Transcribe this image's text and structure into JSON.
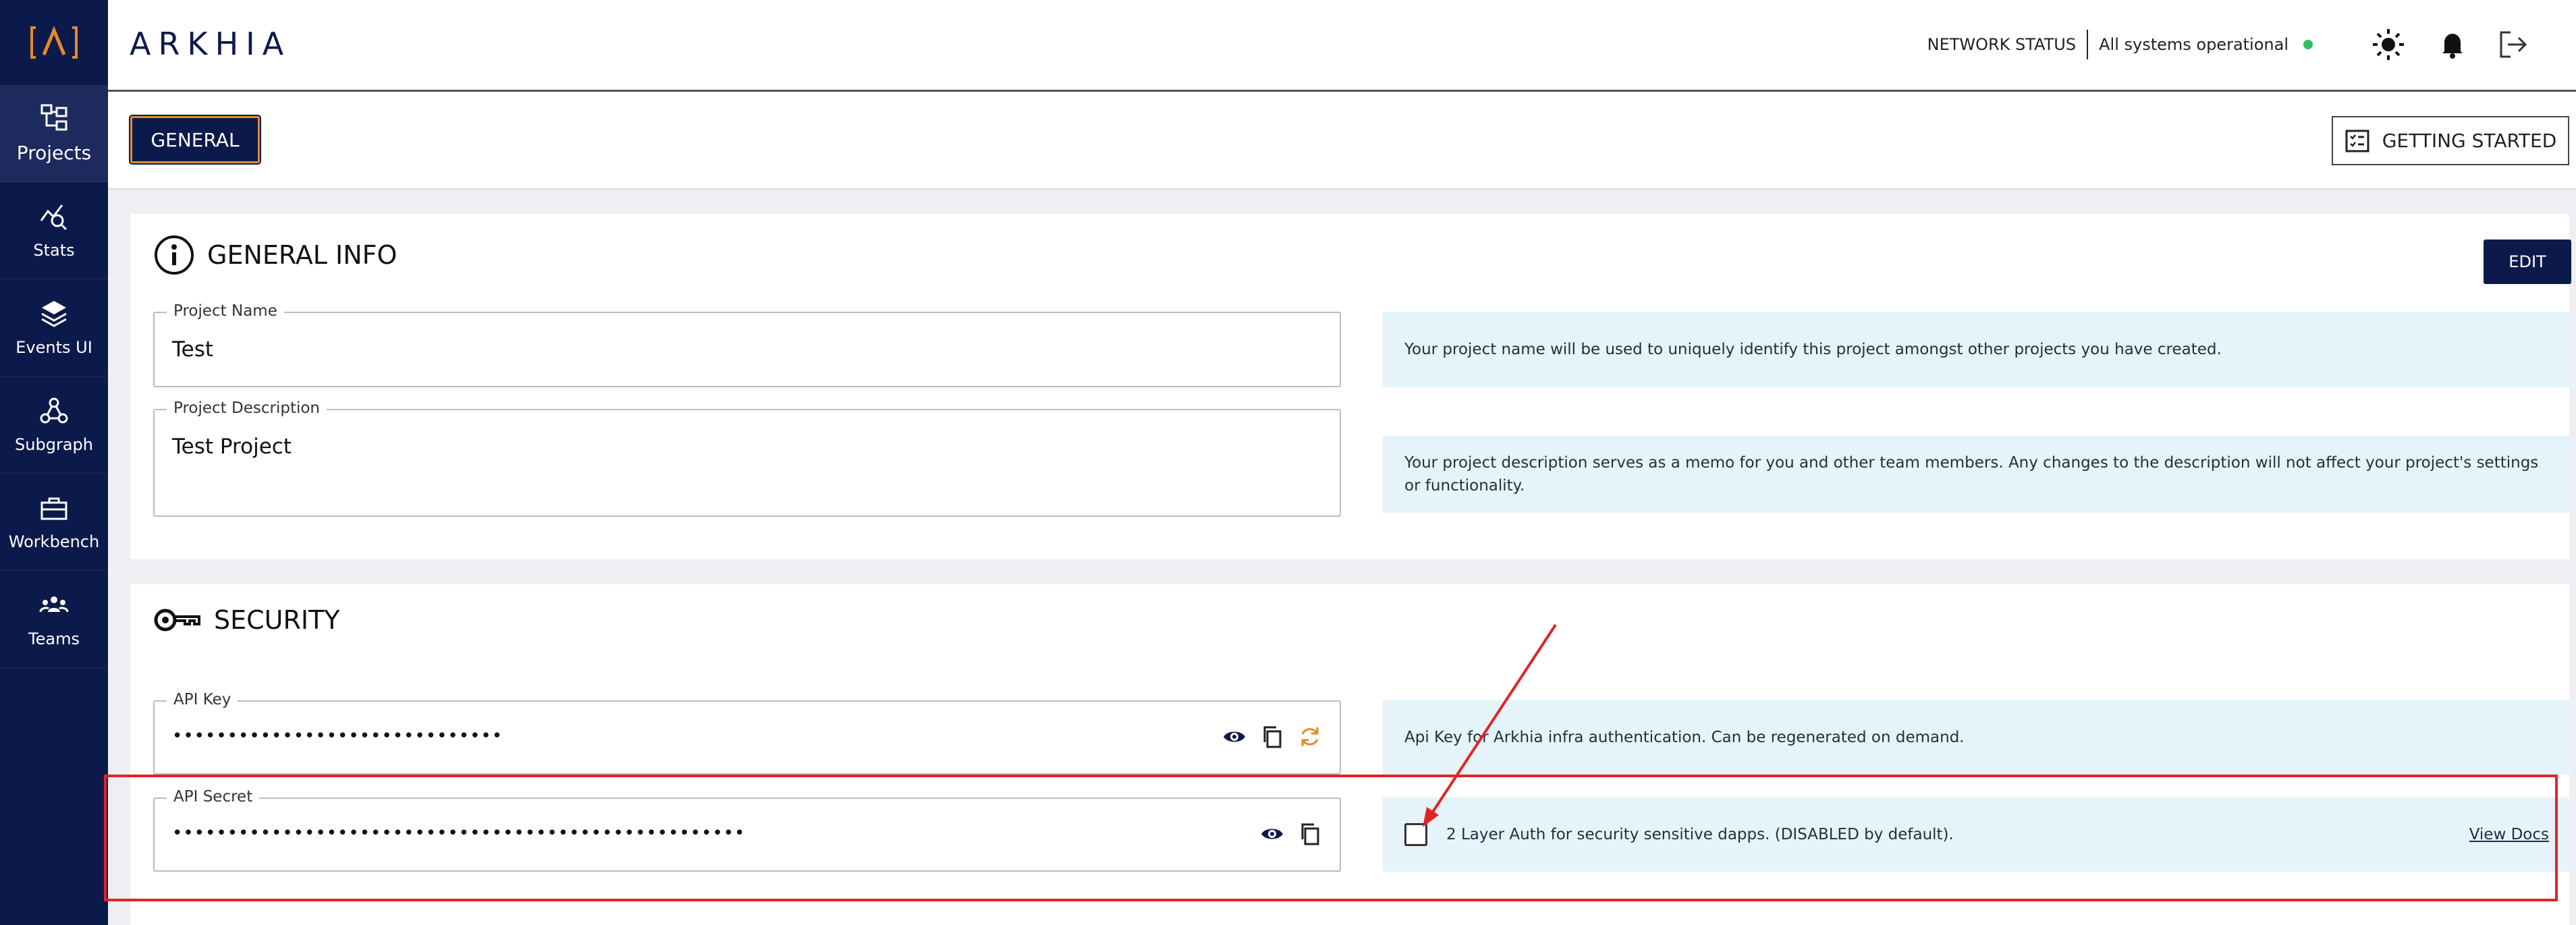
{
  "brand": {
    "logo_glyph": "[Λ]",
    "name": "ARKHIA"
  },
  "sidebar": {
    "items": [
      {
        "label": "Projects",
        "icon": "projects-icon"
      },
      {
        "label": "Stats",
        "icon": "stats-icon"
      },
      {
        "label": "Events UI",
        "icon": "events-icon"
      },
      {
        "label": "Subgraph",
        "icon": "subgraph-icon"
      },
      {
        "label": "Workbench",
        "icon": "workbench-icon"
      },
      {
        "label": "Teams",
        "icon": "teams-icon"
      }
    ]
  },
  "header": {
    "network_label": "NETWORK STATUS",
    "network_status": "All systems operational",
    "status_color": "#2fbf5b"
  },
  "tabs": {
    "general": "GENERAL",
    "getting_started": "GETTING STARTED"
  },
  "general_info": {
    "title": "GENERAL INFO",
    "edit_label": "EDIT",
    "project_name_label": "Project Name",
    "project_name_value": "Test",
    "project_name_help": "Your project name will be used to uniquely identify this project amongst other projects you have created.",
    "project_desc_label": "Project Description",
    "project_desc_value": "Test Project",
    "project_desc_help": "Your project description serves as a memo for you and other team members. Any changes to the description will not affect your project's settings or functionality."
  },
  "security": {
    "title": "SECURITY",
    "api_key_label": "API Key",
    "api_key_value": "••••••••••••••••••••••••••••••",
    "api_key_help": "Api Key for Arkhia infra authentication. Can be regenerated on demand.",
    "api_secret_label": "API Secret",
    "api_secret_value": "••••••••••••••••••••••••••••••••••••••••••••••••••••",
    "two_factor_text": "2 Layer Auth for security sensitive dapps. (DISABLED by default).",
    "two_factor_checked": false,
    "view_docs": "View Docs"
  },
  "colors": {
    "navy": "#0c1a4b",
    "accent_orange": "#e48a2b",
    "info_bg": "#e5f4fa",
    "highlight_red": "#e02525"
  }
}
